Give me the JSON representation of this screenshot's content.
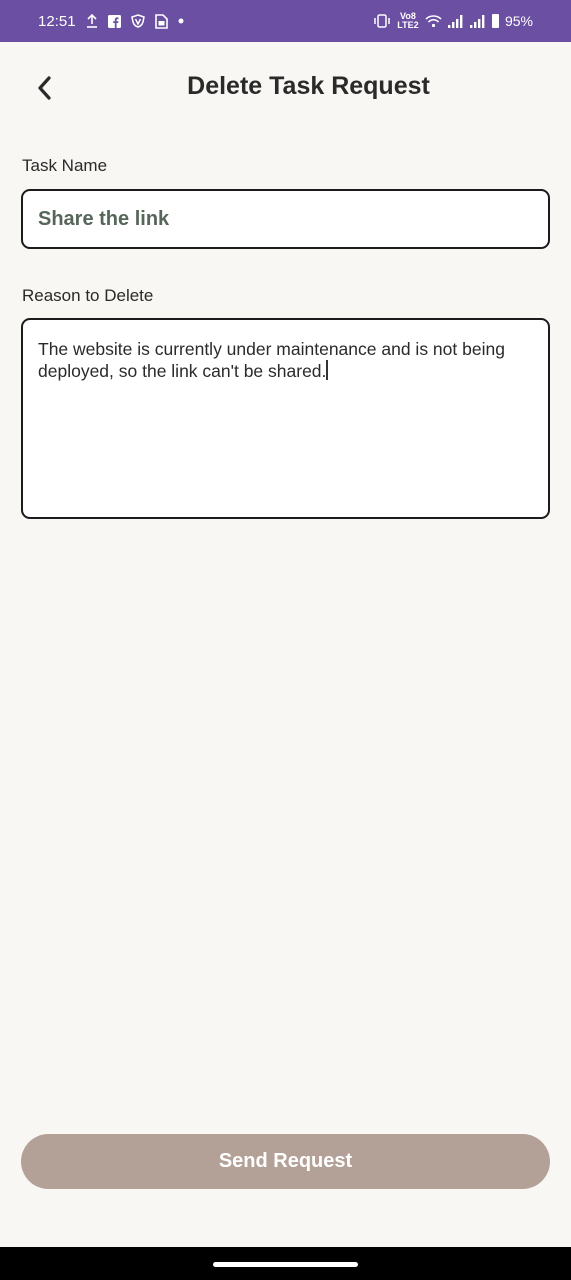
{
  "status_bar": {
    "time": "12:51",
    "notification_icons": [
      "upload-icon",
      "facebook-icon",
      "vpn-icon",
      "sim-icon",
      "dot-icon"
    ],
    "volte_label": "Vo8 LTE2",
    "battery": "95%"
  },
  "header": {
    "title": "Delete Task Request"
  },
  "form": {
    "task_name_label": "Task Name",
    "task_name_value": "Share the link",
    "reason_label": "Reason to Delete",
    "reason_value": "The website is currently under maintenance and is not being deployed, so the link can't be shared."
  },
  "actions": {
    "send_label": "Send Request"
  },
  "colors": {
    "status_bar": "#6a4fa3",
    "background": "#f9f7f3",
    "button": "#b3a197",
    "task_text": "#56665a"
  }
}
